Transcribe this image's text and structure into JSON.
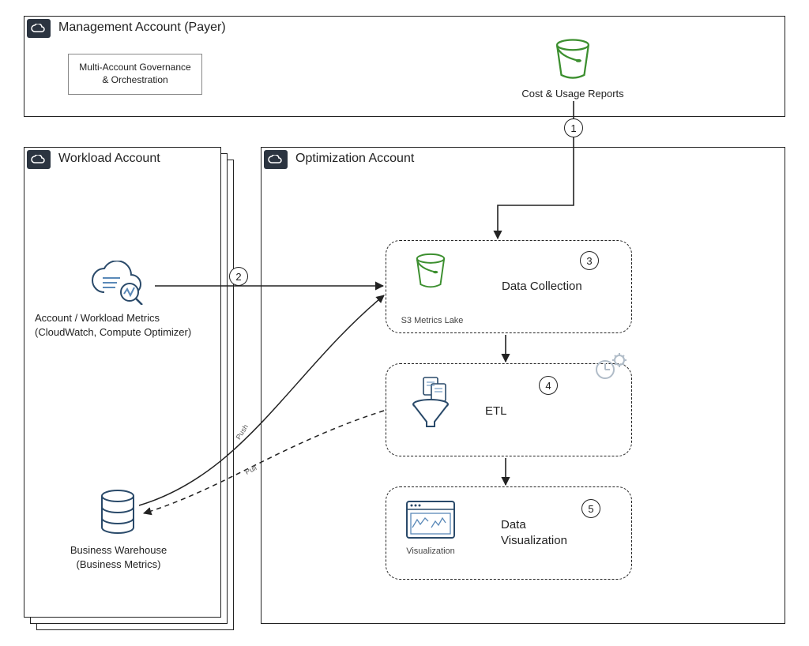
{
  "management": {
    "title": "Management Account (Payer)",
    "governance": "Multi-Account Governance\n& Orchestration",
    "cur_label": "Cost & Usage Reports"
  },
  "workload": {
    "title": "Workload Account",
    "metrics_label": "Account / Workload Metrics\n(CloudWatch, Compute Optimizer)",
    "warehouse_label": "Business Warehouse\n(Business Metrics)"
  },
  "optimization": {
    "title": "Optimization Account",
    "stage3": {
      "title": "Data Collection",
      "icon_label": "S3 Metrics Lake"
    },
    "stage4": {
      "title": "ETL"
    },
    "stage5": {
      "title": "Data\nVisualization",
      "icon_label": "Visualization"
    }
  },
  "steps": {
    "s1": "1",
    "s2": "2",
    "s3": "3",
    "s4": "4",
    "s5": "5"
  },
  "flows": {
    "push": "Push",
    "pull": "Pull"
  },
  "chart_data": {
    "type": "diagram",
    "nodes": [
      {
        "id": "mgmt",
        "label": "Management Account (Payer)",
        "children": [
          "governance",
          "cur"
        ]
      },
      {
        "id": "governance",
        "label": "Multi-Account Governance & Orchestration"
      },
      {
        "id": "cur",
        "label": "Cost & Usage Reports",
        "icon": "s3-bucket"
      },
      {
        "id": "workload",
        "label": "Workload Account",
        "stacked": true,
        "children": [
          "metrics",
          "warehouse"
        ]
      },
      {
        "id": "metrics",
        "label": "Account / Workload Metrics (CloudWatch, Compute Optimizer)",
        "icon": "cloud-metrics"
      },
      {
        "id": "warehouse",
        "label": "Business Warehouse (Business Metrics)",
        "icon": "database"
      },
      {
        "id": "opt",
        "label": "Optimization Account",
        "children": [
          "dc",
          "etl",
          "viz"
        ]
      },
      {
        "id": "dc",
        "label": "Data Collection",
        "step": 3,
        "icon": "s3-bucket",
        "icon_label": "S3 Metrics Lake"
      },
      {
        "id": "etl",
        "label": "ETL",
        "step": 4,
        "icon": "funnel"
      },
      {
        "id": "viz",
        "label": "Data Visualization",
        "step": 5,
        "icon": "dashboard",
        "icon_label": "Visualization"
      }
    ],
    "edges": [
      {
        "from": "cur",
        "to": "dc",
        "step": 1,
        "style": "solid"
      },
      {
        "from": "metrics",
        "to": "dc",
        "step": 2,
        "style": "solid"
      },
      {
        "from": "warehouse",
        "to": "dc",
        "label": "Push",
        "style": "solid-curved"
      },
      {
        "from": "etl",
        "to": "warehouse",
        "label": "Pull",
        "style": "dashed-curved"
      },
      {
        "from": "dc",
        "to": "etl",
        "style": "solid"
      },
      {
        "from": "etl",
        "to": "viz",
        "style": "solid"
      }
    ]
  }
}
